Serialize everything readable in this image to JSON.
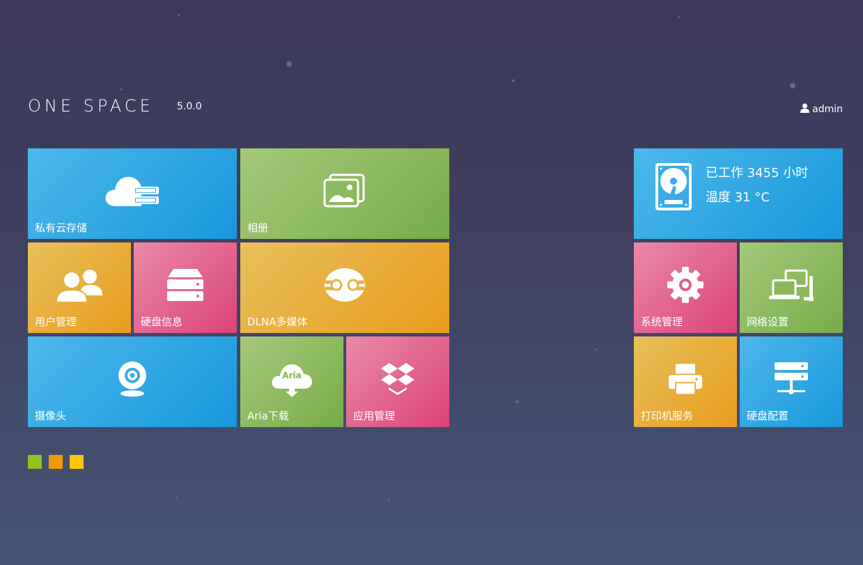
{
  "header": {
    "brand": "ONE SPACE",
    "version": "5.0.0",
    "user": "admin"
  },
  "tiles": {
    "cloud": {
      "label": "私有云存储",
      "icon": "cloud-server-icon"
    },
    "album": {
      "label": "相册",
      "icon": "photo-album-icon"
    },
    "users": {
      "label": "用户管理",
      "icon": "users-icon"
    },
    "disk_info": {
      "label": "硬盘信息",
      "icon": "disk-stack-icon"
    },
    "dlna": {
      "label": "DLNA多媒体",
      "icon": "dlna-icon"
    },
    "camera": {
      "label": "摄像头",
      "icon": "webcam-icon"
    },
    "aria": {
      "label": "Aria下载",
      "icon": "aria-download-icon",
      "icon_text": "Aria"
    },
    "apps": {
      "label": "应用管理",
      "icon": "dropbox-box-icon"
    },
    "system": {
      "label": "系统管理",
      "icon": "gear-icon"
    },
    "network": {
      "label": "网络设置",
      "icon": "network-computers-icon"
    },
    "printer": {
      "label": "打印机服务",
      "icon": "printer-icon"
    },
    "disk_config": {
      "label": "硬盘配置",
      "icon": "server-rack-icon"
    }
  },
  "status": {
    "uptime": "已工作 3455 小时",
    "temperature": "温度 31 °C",
    "icon": "hard-drive-icon"
  },
  "themes": {
    "colors": [
      "#8fc31f",
      "#f39800",
      "#f8c700"
    ]
  }
}
